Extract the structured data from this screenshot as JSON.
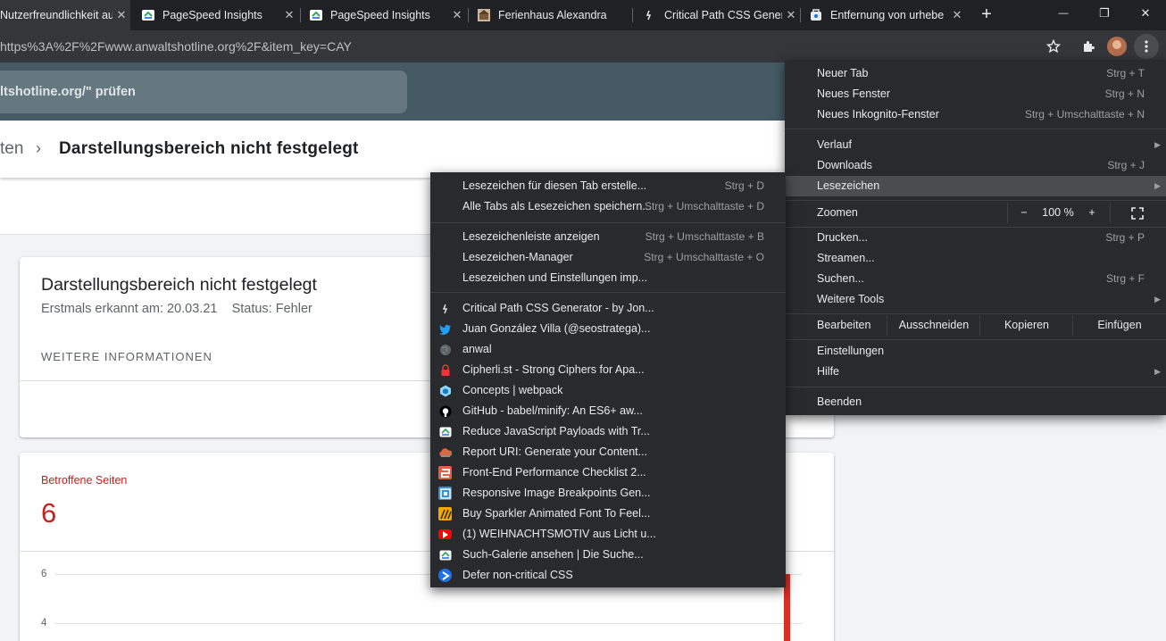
{
  "tabs": [
    {
      "title": "Nutzerfreundlichkeit au",
      "favicon": "search-console-icon"
    },
    {
      "title": "PageSpeed Insights",
      "favicon": "pagespeed-icon"
    },
    {
      "title": "PageSpeed Insights",
      "favicon": "pagespeed-icon"
    },
    {
      "title": "Ferienhaus Alexandra",
      "favicon": "house-image-icon"
    },
    {
      "title": "Critical Path CSS Gener",
      "favicon": "critical-path-icon"
    },
    {
      "title": "Entfernung von urhebe",
      "favicon": "case-icon"
    }
  ],
  "tab_close_glyph": "✕",
  "newtab_glyph": "+",
  "window_controls": {
    "minimize": "—",
    "restore": "❐",
    "close": "✕"
  },
  "address_bar": {
    "url": "https%3A%2F%2Fwww.anwaltshotline.org%2F&item_key=CAY"
  },
  "page": {
    "url_check_text": "ltshotline.org/\" prüfen",
    "breadcrumb_prev": "ten",
    "breadcrumb_chevron": "›",
    "breadcrumb_title": "Darstellungsbereich nicht festgelegt",
    "issue_card": {
      "title": "Darstellungsbereich nicht festgelegt",
      "meta": "Erstmals erkannt am: 20.03.21    Status: Fehler",
      "more_info": "WEITERE INFORMATIONEN"
    },
    "affected_card": {
      "label": "Betroffene Seiten",
      "count": "6",
      "y_ticks": [
        "6",
        "4"
      ]
    }
  },
  "chrome_menu": {
    "items": [
      {
        "label": "Neuer Tab",
        "shortcut": "Strg + T"
      },
      {
        "label": "Neues Fenster",
        "shortcut": "Strg + N"
      },
      {
        "label": "Neues Inkognito-Fenster",
        "shortcut": "Strg + Umschalttaste + N"
      },
      {
        "label": "Verlauf",
        "shortcut": ""
      },
      {
        "label": "Downloads",
        "shortcut": "Strg + J"
      },
      {
        "label": "Lesezeichen",
        "shortcut": ""
      },
      {
        "label": "Drucken...",
        "shortcut": "Strg + P"
      },
      {
        "label": "Streamen...",
        "shortcut": ""
      },
      {
        "label": "Suchen...",
        "shortcut": "Strg + F"
      },
      {
        "label": "Weitere Tools",
        "shortcut": ""
      },
      {
        "label": "Einstellungen",
        "shortcut": ""
      },
      {
        "label": "Hilfe",
        "shortcut": ""
      },
      {
        "label": "Beenden",
        "shortcut": ""
      }
    ],
    "zoom": {
      "label": "Zoomen",
      "minus": "−",
      "value": "100 %",
      "plus": "+"
    },
    "edit": {
      "label": "Bearbeiten",
      "cut": "Ausschneiden",
      "copy": "Kopieren",
      "paste": "Einfügen"
    },
    "submenu_arrow": "▶"
  },
  "bookmarks_menu": {
    "actions": [
      {
        "label": "Lesezeichen für diesen Tab erstelle...",
        "shortcut": "Strg + D"
      },
      {
        "label": "Alle Tabs als Lesezeichen speichern...",
        "shortcut": "Strg + Umschalttaste + D"
      },
      {
        "label": "Lesezeichenleiste anzeigen",
        "shortcut": "Strg + Umschalttaste + B"
      },
      {
        "label": "Lesezeichen-Manager",
        "shortcut": "Strg + Umschalttaste + O"
      },
      {
        "label": "Lesezeichen und Einstellungen imp...",
        "shortcut": ""
      }
    ],
    "bookmarks": [
      {
        "label": "Critical Path CSS Generator - by Jon...",
        "icon": "critical-path-icon",
        "color": "#292a2d",
        "glyph": "ꟾ"
      },
      {
        "label": "Juan González Villa (@seostratega)...",
        "icon": "twitter-icon",
        "color": "#1da1f2",
        "glyph": "🐦"
      },
      {
        "label": "anwal",
        "icon": "globe-icon",
        "color": "#5f6368",
        "glyph": ""
      },
      {
        "label": "Cipherli.st - Strong Ciphers for Apa...",
        "icon": "lock-icon",
        "color": "#e53935",
        "glyph": ""
      },
      {
        "label": "Concepts | webpack",
        "icon": "webpack-icon",
        "color": "#8ed6fb",
        "glyph": ""
      },
      {
        "label": "GitHub - babel/minify: An ES6+ aw...",
        "icon": "github-icon",
        "color": "#000000",
        "glyph": ""
      },
      {
        "label": "Reduce JavaScript Payloads with Tr...",
        "icon": "pagespeed-icon",
        "color": "#ffffff",
        "glyph": ""
      },
      {
        "label": "Report URI: Generate your Content...",
        "icon": "cloud-icon",
        "color": "#e0643f",
        "glyph": ""
      },
      {
        "label": "Front-End Performance Checklist 2...",
        "icon": "smashing-icon",
        "color": "#e85c41",
        "glyph": "S"
      },
      {
        "label": "Responsive Image Breakpoints Gen...",
        "icon": "image-icon",
        "color": "#3b8fd4",
        "glyph": ""
      },
      {
        "label": "Buy Sparkler Animated Font To Feel...",
        "icon": "sparkler-icon",
        "color": "#f2a900",
        "glyph": ""
      },
      {
        "label": "(1) WEIHNACHTSMOTIV aus Licht u...",
        "icon": "youtube-icon",
        "color": "#ff0000",
        "glyph": "▶"
      },
      {
        "label": "Such-Galerie ansehen  |  Die Suche...",
        "icon": "pagespeed-icon",
        "color": "#ffffff",
        "glyph": ""
      },
      {
        "label": "Defer non-critical CSS",
        "icon": "webdev-icon",
        "color": "#1a73e8",
        "glyph": "›"
      }
    ]
  },
  "colors": {
    "tab_strip": "#202124",
    "toolbar": "#35363a",
    "menu_bg": "#292a2d",
    "menu_highlight": "#4a4c50",
    "header_blue": "#455a64",
    "error_red": "#c5221f"
  }
}
